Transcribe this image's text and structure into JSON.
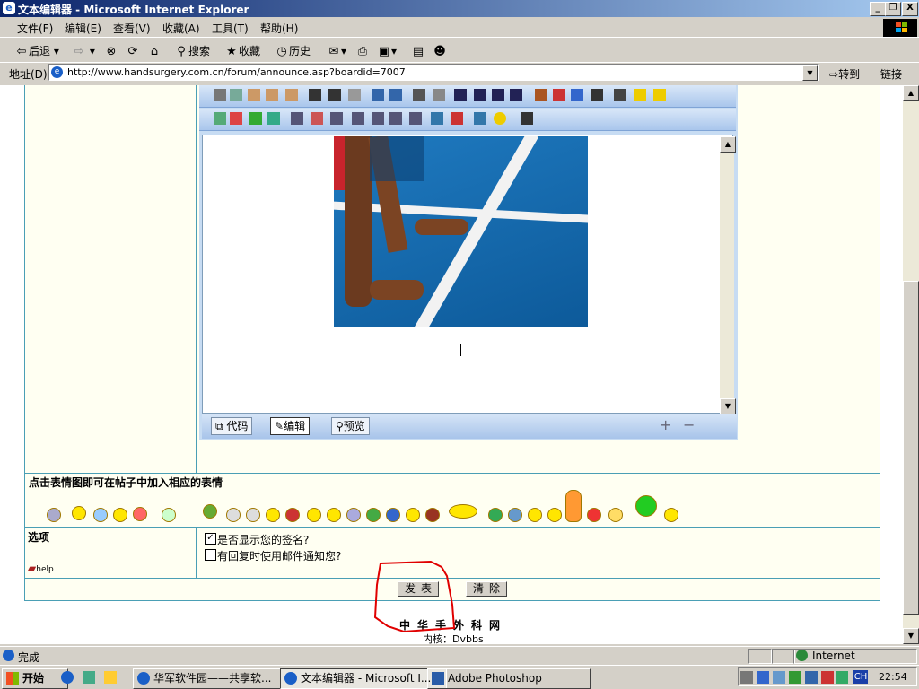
{
  "window": {
    "title": "文本编辑器 - Microsoft Internet Explorer",
    "minimize": "_",
    "maximize": "❐",
    "close": "X"
  },
  "menu": [
    "文件(F)",
    "编辑(E)",
    "查看(V)",
    "收藏(A)",
    "工具(T)",
    "帮助(H)"
  ],
  "toolbar": {
    "back": "后退",
    "search": "搜索",
    "favorites": "收藏",
    "history": "历史"
  },
  "address": {
    "label": "地址(D)",
    "url": "http://www.handsurgery.com.cn/forum/announce.asp?boardid=7007",
    "go": "转到",
    "links": "链接"
  },
  "editor": {
    "modes": [
      "代码",
      "编辑",
      "预览"
    ],
    "active_mode": "编辑"
  },
  "emoticons": {
    "title": "点击表情图即可在帖子中加入相应的表情"
  },
  "options": {
    "label": "选项",
    "help": "help",
    "items": [
      {
        "text": "是否显示您的签名?",
        "checked": true
      },
      {
        "text": "有回复时使用邮件通知您?",
        "checked": false
      }
    ]
  },
  "buttons": {
    "submit": "发表",
    "clear": "清除"
  },
  "footer": {
    "site": "中华手外科网",
    "kernel": "内核：Dvbbs"
  },
  "status": {
    "text": "完成",
    "zone": "Internet"
  },
  "taskbar": {
    "start": "开始",
    "tasks": [
      {
        "label": "华军软件园——共享软...",
        "active": false
      },
      {
        "label": "文本编辑器 - Microsoft I...",
        "active": true
      },
      {
        "label": "Adobe Photoshop",
        "active": false
      }
    ],
    "lang": "CH",
    "clock": "22:54"
  },
  "colors": {
    "border": "#4a9fb5",
    "rowbg": "#fffff2",
    "annotation": "#e00000"
  }
}
